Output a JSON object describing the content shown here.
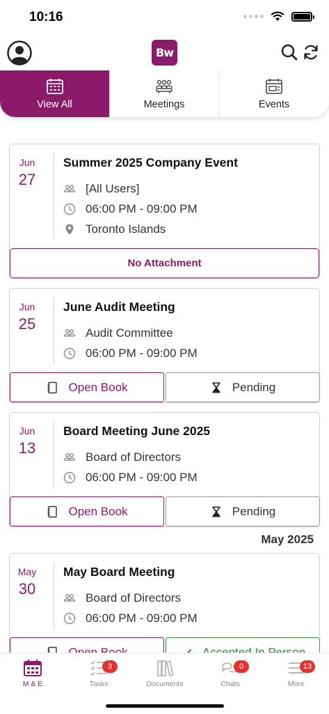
{
  "status_bar": {
    "time": "10:16"
  },
  "header": {
    "logo_text": "Bw"
  },
  "tabs": [
    {
      "label": "View All",
      "icon": "calendar-icon",
      "active": true
    },
    {
      "label": "Meetings",
      "icon": "meeting-people-icon",
      "active": false
    },
    {
      "label": "Events",
      "icon": "event-calendar-icon",
      "active": false
    }
  ],
  "items": [
    {
      "month": "Jun",
      "day": "27",
      "title": "Summer 2025 Company Event",
      "attendees": "[All Users]",
      "time": "06:00 PM - 09:00 PM",
      "location": "Toronto Islands",
      "attachment_label": "No Attachment"
    },
    {
      "month": "Jun",
      "day": "25",
      "title": "June Audit Meeting",
      "attendees": "Audit Committee",
      "time": "06:00 PM - 09:00 PM",
      "book_label": "Open Book",
      "status_label": "Pending"
    },
    {
      "month": "Jun",
      "day": "13",
      "title": "Board Meeting June 2025",
      "attendees": "Board of Directors",
      "time": "06:00 PM - 09:00 PM",
      "book_label": "Open Book",
      "status_label": "Pending"
    },
    {
      "month": "May",
      "day": "30",
      "title": "May Board Meeting",
      "attendees": "Board of Directors",
      "time": "06:00 PM - 09:00 PM",
      "book_label": "Open Book",
      "status_label": "Accepted In Person"
    }
  ],
  "month_header": "May 2025",
  "bottom_nav": [
    {
      "label": "M & E",
      "icon": "calendar-icon",
      "active": true,
      "badge": ""
    },
    {
      "label": "Tasks",
      "icon": "tasks-checklist-icon",
      "active": false,
      "badge": "3"
    },
    {
      "label": "Documents",
      "icon": "books-icon",
      "active": false,
      "badge": ""
    },
    {
      "label": "Chats",
      "icon": "chat-bubbles-icon",
      "active": false,
      "badge": "0"
    },
    {
      "label": "More",
      "icon": "hamburger-menu-icon",
      "active": false,
      "badge": "13"
    }
  ],
  "colors": {
    "brand": "#8c1a6a",
    "badge": "#e53030",
    "accepted": "#2e8a2e"
  }
}
